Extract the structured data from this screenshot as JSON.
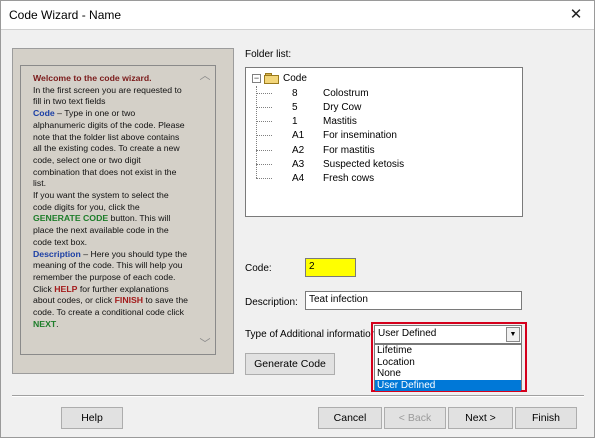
{
  "window": {
    "title": "Code Wizard - Name",
    "close_glyph": "✕"
  },
  "help": {
    "welcome": "Welcome to the code wizard.",
    "p1": "In the first screen you are requested to fill in two text fields",
    "code_kw": "Code",
    "p2": " – Type in one or two alphanumeric digits of the code. Please note that the folder list above contains all the existing codes. To create a new code, select one or two digit combination that does not exist in the list.",
    "p3": "If you want the system to select the code digits for you, click the",
    "generate_kw": "GENERATE CODE",
    "p4": " button. This will place the next available code in the code text box.",
    "description_kw": "Description",
    "p5": " – Here you should type the meaning of the code. This will help you remember the purpose of each code.",
    "p6a": "Click ",
    "help_kw": "HELP",
    "p6b": " for further explanations about codes, or click ",
    "finish_kw": "FINISH",
    "p6c": " to save the code. To create a conditional code click ",
    "next_kw": "NEXT",
    "p6d": ".",
    "scroll_up": "︿",
    "scroll_down": "﹀"
  },
  "folder_list": {
    "label": "Folder list:",
    "expander": "−",
    "root": "Code",
    "items": [
      {
        "code": "8",
        "name": "Colostrum"
      },
      {
        "code": "5",
        "name": "Dry Cow"
      },
      {
        "code": "1",
        "name": "Mastitis"
      },
      {
        "code": "A1",
        "name": "For insemination"
      },
      {
        "code": "A2",
        "name": " For mastitis"
      },
      {
        "code": "A3",
        "name": "Suspected ketosis"
      },
      {
        "code": "A4",
        "name": "Fresh cows"
      }
    ]
  },
  "form": {
    "code_label": "Code:",
    "code_value": "2",
    "description_label": "Description:",
    "description_value": "Teat infection",
    "type_label": "Type of Additional information",
    "type_selected": "User Defined",
    "type_arrow": "▼",
    "type_options": [
      "Lifetime",
      "Location",
      "None",
      "User Defined"
    ],
    "type_options_selected_index": 3,
    "generate_button": "Generate Code"
  },
  "footer": {
    "help": "Help",
    "cancel": "Cancel",
    "back": "< Back",
    "next": "Next >",
    "finish": "Finish"
  },
  "colors": {
    "code_field_bg": "#ffff00",
    "highlight_border": "#d5001c",
    "selected_option": "#0078d7"
  }
}
